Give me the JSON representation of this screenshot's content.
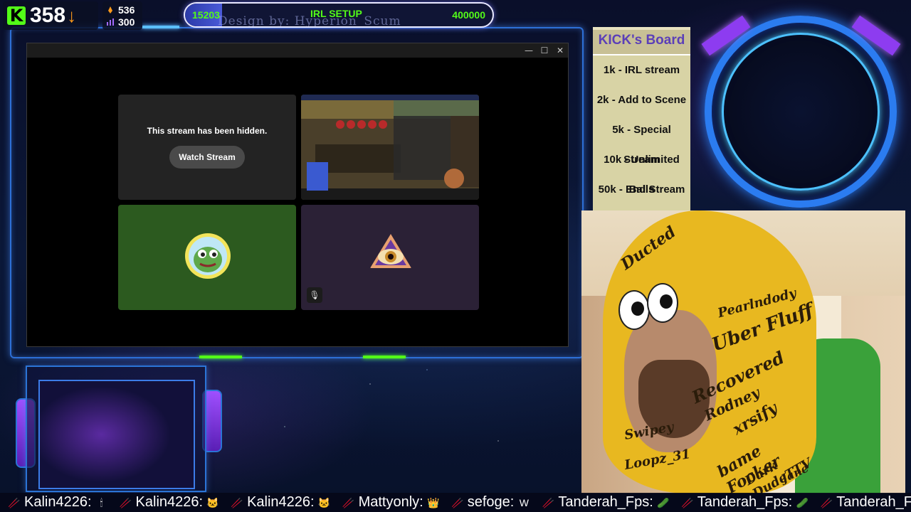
{
  "counter": {
    "viewers": "358",
    "stat_top": "536",
    "stat_bottom": "300"
  },
  "goal": {
    "current": "15203",
    "label": "IRL SETUP",
    "target": "400000",
    "credit": "Design by: Hyperion_Scum",
    "progress_fraction": 0.038
  },
  "window": {
    "minimize": "—",
    "maximize": "☐",
    "close": "✕"
  },
  "tiles": {
    "hidden_message": "This stream has been hidden.",
    "watch_button": "Watch Stream"
  },
  "board": {
    "title": "KICK's Board",
    "items": [
      "1k - IRL stream",
      "2k - Add to Scene",
      "5k - Special Stream",
      "10k - Unlimited Balls",
      "50k - End Stream"
    ]
  },
  "webcam": {
    "scribbles": [
      "Uber Fluff",
      "Recovered",
      "Rodney",
      "Pearlndody",
      "xrsify",
      "Swipey",
      "Loopz_31",
      "bame Focker",
      "Dark DudeTTV",
      "Jane",
      "Ducted"
    ]
  },
  "chat": [
    {
      "user": "Kalin4226:",
      "emote": "🕯"
    },
    {
      "user": "Kalin4226:",
      "emote": "🐱"
    },
    {
      "user": "Kalin4226:",
      "emote": "🐱"
    },
    {
      "user": "Mattyonly:",
      "emote": "👑"
    },
    {
      "user": "sefoge:",
      "emote": "W"
    },
    {
      "user": "Tanderah_Fps:",
      "emote": "🥒"
    },
    {
      "user": "Tanderah_Fps:",
      "emote": "🥒"
    },
    {
      "user": "Tanderah_Fps:",
      "emote": "🥒"
    }
  ],
  "colors": {
    "kick_green": "#53fc18",
    "frame_blue": "#2d6fd6",
    "board_title": "#5b3fb8"
  }
}
